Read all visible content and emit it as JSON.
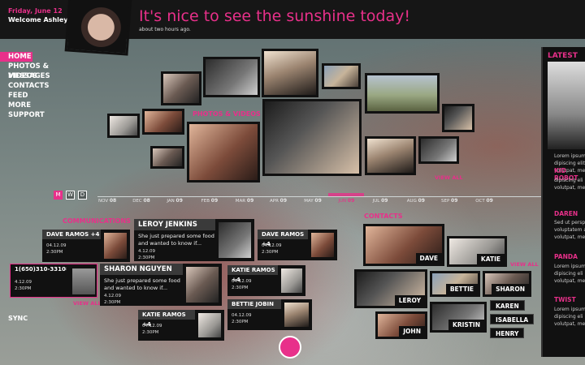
{
  "header": {
    "date": "Friday, June 12",
    "welcome": "Welcome Ashley B!",
    "status_text": "It's nice to see the sunshine today!",
    "status_time": "about two hours ago."
  },
  "nav": {
    "items": [
      "HOME",
      "PHOTOS & VIDEOS",
      "MESSAGES",
      "CONTACTS",
      "FEED",
      "MORE",
      "SUPPORT"
    ],
    "active": "HOME",
    "sync": "SYNC"
  },
  "photos": {
    "label": "PHOTOS & VIDEOS",
    "view_all": "VIEW ALL"
  },
  "timeline": {
    "modes": [
      "M",
      "W",
      "D"
    ],
    "active_mode": "M",
    "ticks": [
      {
        "m": "NOV",
        "y": "08"
      },
      {
        "m": "DEC",
        "y": "08"
      },
      {
        "m": "JAN",
        "y": "09"
      },
      {
        "m": "FEB",
        "y": "09"
      },
      {
        "m": "MAR",
        "y": "09"
      },
      {
        "m": "APR",
        "y": "09"
      },
      {
        "m": "MAY",
        "y": "09"
      },
      {
        "m": "JUN",
        "y": "09"
      },
      {
        "m": "JUL",
        "y": "09"
      },
      {
        "m": "AUG",
        "y": "09"
      },
      {
        "m": "SEP",
        "y": "09"
      },
      {
        "m": "OCT",
        "y": "09"
      }
    ]
  },
  "communications": {
    "label": "COMMUNICATIONS",
    "view_all": "VIEW ALL",
    "phone_card": {
      "number": "1(650)310-3310",
      "extra": "c",
      "date": "4.12.09",
      "time": "2:30PM"
    },
    "cards": [
      {
        "name": "DAVE RAMOS +4",
        "date": "04.12.09",
        "time": "2:30PM"
      },
      {
        "name": "LEROY JENKINS",
        "msg": "She just prepared some food and wanted to know if...",
        "date": "4.12.09",
        "time": "2:30PM"
      },
      {
        "name": "DAVE RAMOS +4",
        "date": "04.12.09",
        "time": "2:30PM"
      },
      {
        "name": "SHARON NGUYEN",
        "msg": "She just prepared some food and wanted to know if...",
        "date": "4.12.09",
        "time": "2:30PM"
      },
      {
        "name": "KATIE RAMOS +4",
        "date": "04.12.09",
        "time": "2:30PM"
      },
      {
        "name": "BETTIE JOBIN",
        "date": "04.12.09",
        "time": "2:30PM"
      },
      {
        "name": "KATIE RAMOS +4",
        "date": "04.12.09",
        "time": "2:30PM"
      }
    ]
  },
  "contacts": {
    "label": "CONTACTS",
    "view_all": "VIEW ALL",
    "people": [
      "DAVE",
      "KATIE",
      "LEROY",
      "BETTIE",
      "SHARON",
      "JOHN",
      "KRISTIN"
    ],
    "names_only": [
      "KAREN",
      "ISABELLA",
      "HENRY"
    ]
  },
  "latest": {
    "title": "LATEST",
    "items": [
      {
        "name": "",
        "body": "Lorem ipsum\ndipiscing elit,\nvolutpat, me"
      },
      {
        "name": "KID ROBOT",
        "body": "dipiscing eli\nvolutpat, me"
      },
      {
        "name": "DAREN",
        "body": "Sed ut persp\nvoluptatem a\nvolutpat, me"
      },
      {
        "name": "PANDA",
        "body": "Lorem ipsum\ndipiscing eli\nvolutpat, me"
      },
      {
        "name": "TWIST",
        "body": "Lorem ipsum\ndipiscing eli\nvolutpat, me"
      }
    ]
  },
  "colors": {
    "accent": "#e8308a",
    "panel": "#111111"
  }
}
